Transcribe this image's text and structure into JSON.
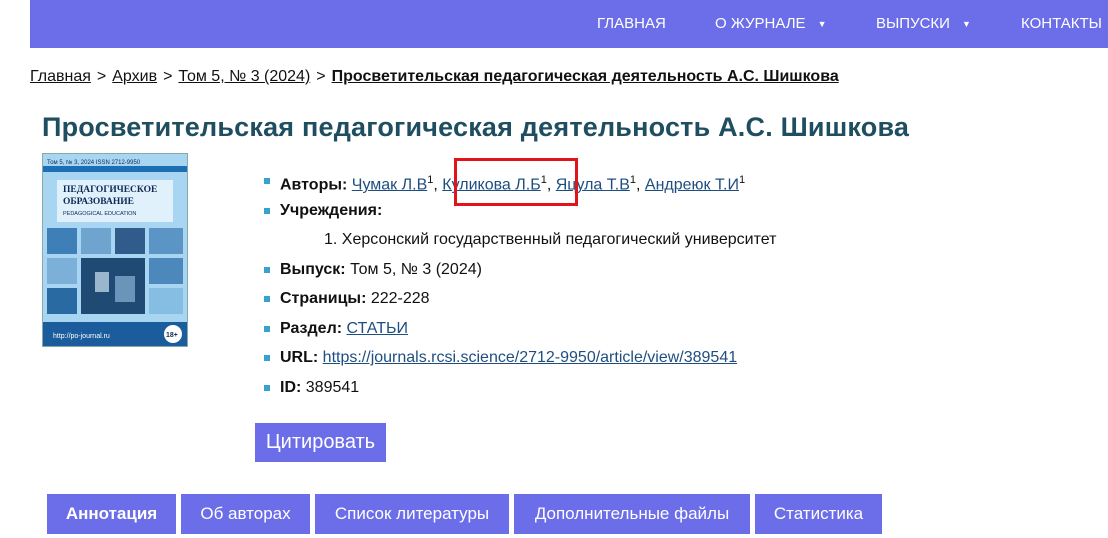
{
  "nav": {
    "items": [
      {
        "label": "ГЛАВНАЯ",
        "dropdown": false
      },
      {
        "label": "О ЖУРНАЛЕ",
        "dropdown": true
      },
      {
        "label": "ВЫПУСКИ",
        "dropdown": true
      },
      {
        "label": "КОНТАКТЫ",
        "dropdown": false
      }
    ],
    "caret": "▼"
  },
  "breadcrumb": {
    "home": "Главная",
    "archive": "Архив",
    "issue": "Том 5, № 3 (2024)",
    "current": "Просветительская педагогическая деятельность А.С. Шишкова",
    "sep": ">"
  },
  "article": {
    "title": "Просветительская педагогическая деятельность А.С. Шишкова",
    "authors_label": "Авторы:",
    "authors": [
      {
        "name": "Чумак Л.В",
        "sup": "1"
      },
      {
        "name": "Куликова Л.Б",
        "sup": "1"
      },
      {
        "name": "Яцула Т.В",
        "sup": "1"
      },
      {
        "name": "Андреюк Т.И",
        "sup": "1"
      }
    ],
    "institutions_label": "Учреждения:",
    "institution_1": "1. Херсонский государственный педагогический университет",
    "issue_label": "Выпуск:",
    "issue_value": "Том 5, № 3 (2024)",
    "pages_label": "Страницы:",
    "pages_value": "222-228",
    "section_label": "Раздел:",
    "section_value": "СТАТЬИ",
    "url_label": "URL:",
    "url_value": "https://journals.rcsi.science/2712-9950/article/view/389541",
    "id_label": "ID:",
    "id_value": "389541"
  },
  "cover": {
    "top_line": "Том 5, № 3, 2024   ISSN 2712-9950",
    "title_1": "ПЕДАГОГИЧЕСКОЕ",
    "title_2": "ОБРАЗОВАНИЕ",
    "subtitle": "PEDAGOGICAL EDUCATION",
    "url": "http://po-journal.ru",
    "age": "18+"
  },
  "cite_button": "Цитировать",
  "tabs": [
    "Аннотация",
    "Об авторах",
    "Список литературы",
    "Дополнительные файлы",
    "Статистика"
  ],
  "colors": {
    "accent": "#6b6ee8",
    "title": "#1e4e60",
    "highlight": "#e0141b"
  }
}
